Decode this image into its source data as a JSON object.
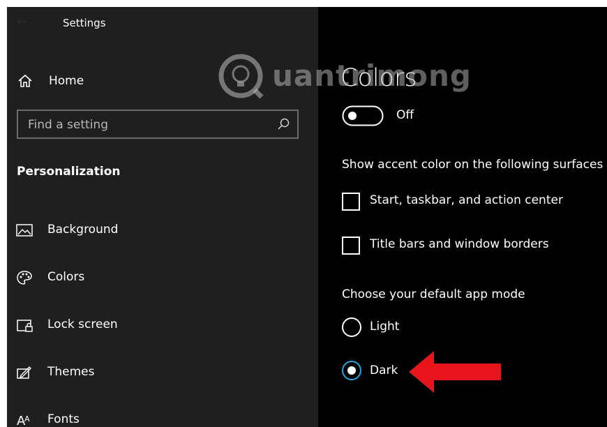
{
  "window": {
    "title": "Settings"
  },
  "sidebar": {
    "home_label": "Home",
    "search_placeholder": "Find a setting",
    "section_title": "Personalization",
    "items": [
      {
        "label": "Background",
        "icon": "image-icon"
      },
      {
        "label": "Colors",
        "icon": "palette-icon"
      },
      {
        "label": "Lock screen",
        "icon": "lock-screen-icon"
      },
      {
        "label": "Themes",
        "icon": "themes-icon"
      },
      {
        "label": "Fonts",
        "icon": "fonts-icon"
      }
    ]
  },
  "main": {
    "title": "Colors",
    "toggle": {
      "state": "Off",
      "on": false
    },
    "accent_heading": "Show accent color on the following surfaces",
    "checkboxes": [
      {
        "label": "Start, taskbar, and action center",
        "checked": false
      },
      {
        "label": "Title bars and window borders",
        "checked": false
      }
    ],
    "app_mode_heading": "Choose your default app mode",
    "radios": [
      {
        "label": "Light",
        "selected": false
      },
      {
        "label": "Dark",
        "selected": true
      }
    ]
  },
  "watermark": {
    "text": "uantrimong"
  },
  "colors": {
    "sidebar_bg": "#1f1f1f",
    "main_bg": "#000000",
    "accent": "#2aa3d8",
    "arrow": "#e8141a"
  }
}
